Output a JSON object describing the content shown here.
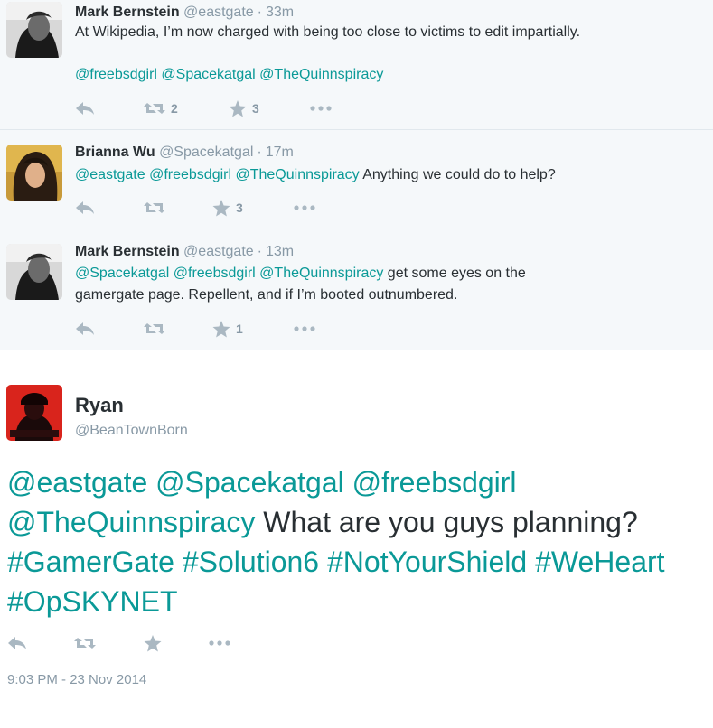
{
  "replies": [
    {
      "name": "Mark Bernstein",
      "handle": "@eastgate",
      "time": "33m",
      "line1_parts": [
        {
          "t": "At Wikipedia, I’m now charged with being too close to victims to edit impartially.",
          "link": false
        }
      ],
      "line2_parts": [
        {
          "t": "@freebsdgirl",
          "link": true
        },
        {
          "t": " ",
          "link": false
        },
        {
          "t": "@Spacekatgal",
          "link": true
        },
        {
          "t": " ",
          "link": false
        },
        {
          "t": "@TheQuinnspiracy",
          "link": true
        }
      ],
      "retweets": "2",
      "favorites": "3"
    },
    {
      "name": "Brianna Wu",
      "handle": "@Spacekatgal",
      "time": "17m",
      "line1_parts": [
        {
          "t": "@eastgate",
          "link": true
        },
        {
          "t": " ",
          "link": false
        },
        {
          "t": "@freebsdgirl",
          "link": true
        },
        {
          "t": " ",
          "link": false
        },
        {
          "t": "@TheQuinnspiracy",
          "link": true
        },
        {
          "t": " Anything we could do to help?",
          "link": false
        }
      ],
      "retweets": "",
      "favorites": "3"
    },
    {
      "name": "Mark Bernstein",
      "handle": "@eastgate",
      "time": "13m",
      "line1_parts": [
        {
          "t": "@Spacekatgal",
          "link": true
        },
        {
          "t": " ",
          "link": false
        },
        {
          "t": "@freebsdgirl",
          "link": true
        },
        {
          "t": " ",
          "link": false
        },
        {
          "t": "@TheQuinnspiracy",
          "link": true
        },
        {
          "t": " get some eyes on the",
          "link": false
        }
      ],
      "line2_parts": [
        {
          "t": "gamergate page. Repellent, and if I’m booted outnumbered.",
          "link": false
        }
      ],
      "retweets": "",
      "favorites": "1"
    }
  ],
  "main": {
    "name": "Ryan",
    "handle": "@BeanTownBorn",
    "text_parts": [
      {
        "t": "@eastgate",
        "link": true
      },
      {
        "t": " ",
        "link": false
      },
      {
        "t": "@Spacekatgal",
        "link": true
      },
      {
        "t": " ",
        "link": false
      },
      {
        "t": "@freebsdgirl",
        "link": true
      },
      {
        "t": " ",
        "link": false
      },
      {
        "t": "@TheQuinnspiracy",
        "link": true
      },
      {
        "t": " What are you guys planning? ",
        "link": false
      },
      {
        "t": "#GamerGate",
        "link": true
      },
      {
        "t": " ",
        "link": false
      },
      {
        "t": "#Solution6",
        "link": true
      },
      {
        "t": " ",
        "link": false
      },
      {
        "t": "#NotYourShield",
        "link": true
      },
      {
        "t": " ",
        "link": false
      },
      {
        "t": "#WeHeart",
        "link": true
      },
      {
        "t": " ",
        "link": false
      },
      {
        "t": "#OpSKYNET",
        "link": true
      }
    ],
    "timestamp": "9:03 PM - 23 Nov 2014",
    "dot_separator": "·"
  },
  "icons": {
    "reply": "reply-icon",
    "retweet": "retweet-icon",
    "favorite": "star-icon",
    "more": "more-icon",
    "avatar_mark": "avatar-photo",
    "avatar_brianna": "avatar-photo",
    "avatar_ryan": "avatar-photo"
  },
  "colors": {
    "link": "#0a9997",
    "muted": "#8899a6",
    "icon": "#aab8c2",
    "reply_bg": "#f5f8fa",
    "text": "#292f33"
  }
}
